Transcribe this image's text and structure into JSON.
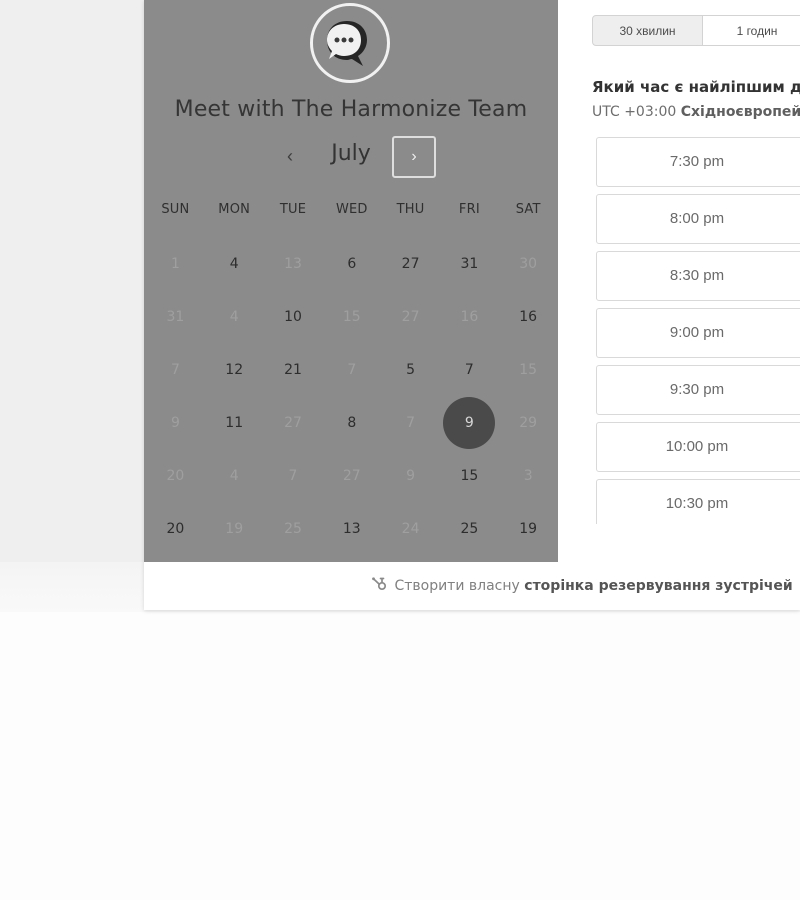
{
  "booking": {
    "avatar_icon": "chat-bubble-icon",
    "title": "Meet with The Harmonize Team",
    "calendar": {
      "month": "July",
      "prev_icon": "‹",
      "next_icon": "›",
      "weekdays": [
        "SUN",
        "MON",
        "TUE",
        "WED",
        "THU",
        "FRI",
        "SAT"
      ],
      "weeks": [
        [
          {
            "label": "1",
            "available": false
          },
          {
            "label": "4",
            "available": true
          },
          {
            "label": "13",
            "available": false
          },
          {
            "label": "6",
            "available": true
          },
          {
            "label": "27",
            "available": true
          },
          {
            "label": "31",
            "available": true
          },
          {
            "label": "30",
            "available": false
          }
        ],
        [
          {
            "label": "31",
            "available": false
          },
          {
            "label": "4",
            "available": false
          },
          {
            "label": "10",
            "available": true
          },
          {
            "label": "15",
            "available": false
          },
          {
            "label": "27",
            "available": false
          },
          {
            "label": "16",
            "available": false
          },
          {
            "label": "16",
            "available": true
          }
        ],
        [
          {
            "label": "7",
            "available": false
          },
          {
            "label": "12",
            "available": true
          },
          {
            "label": "21",
            "available": true
          },
          {
            "label": "7",
            "available": false
          },
          {
            "label": "5",
            "available": true
          },
          {
            "label": "7",
            "available": true
          },
          {
            "label": "15",
            "available": false
          }
        ],
        [
          {
            "label": "9",
            "available": false
          },
          {
            "label": "11",
            "available": true
          },
          {
            "label": "27",
            "available": false
          },
          {
            "label": "8",
            "available": true
          },
          {
            "label": "7",
            "available": false
          },
          {
            "label": "9",
            "available": true,
            "selected": true
          },
          {
            "label": "29",
            "available": false
          }
        ],
        [
          {
            "label": "20",
            "available": false
          },
          {
            "label": "4",
            "available": false
          },
          {
            "label": "7",
            "available": false
          },
          {
            "label": "27",
            "available": false
          },
          {
            "label": "9",
            "available": false
          },
          {
            "label": "15",
            "available": true
          },
          {
            "label": "3",
            "available": false
          }
        ],
        [
          {
            "label": "20",
            "available": true
          },
          {
            "label": "19",
            "available": false
          },
          {
            "label": "25",
            "available": false
          },
          {
            "label": "13",
            "available": true
          },
          {
            "label": "24",
            "available": false
          },
          {
            "label": "25",
            "available": true
          },
          {
            "label": "19",
            "available": true
          }
        ]
      ]
    },
    "duration_tabs": [
      {
        "label": "30 хвилин",
        "selected": true
      },
      {
        "label": "1 годин",
        "selected": false
      }
    ],
    "question": "Який час є найліпшим дл",
    "timezone": {
      "offset": "UTC +03:00",
      "name": "Східноєвропейсь"
    },
    "times": [
      "7:30 pm",
      "8:00 pm",
      "8:30 pm",
      "9:00 pm",
      "9:30 pm",
      "10:00 pm",
      "10:30 pm"
    ],
    "footer": {
      "icon": "hubspot-sprocket-icon",
      "prefix": "Створити власну",
      "bold": "сторінка резервування зустрічей"
    }
  },
  "colors": {
    "left_panel": "#8b8b8b",
    "selected_day": "#4a4a4a",
    "background": "#efefef",
    "card": "#ffffff"
  }
}
